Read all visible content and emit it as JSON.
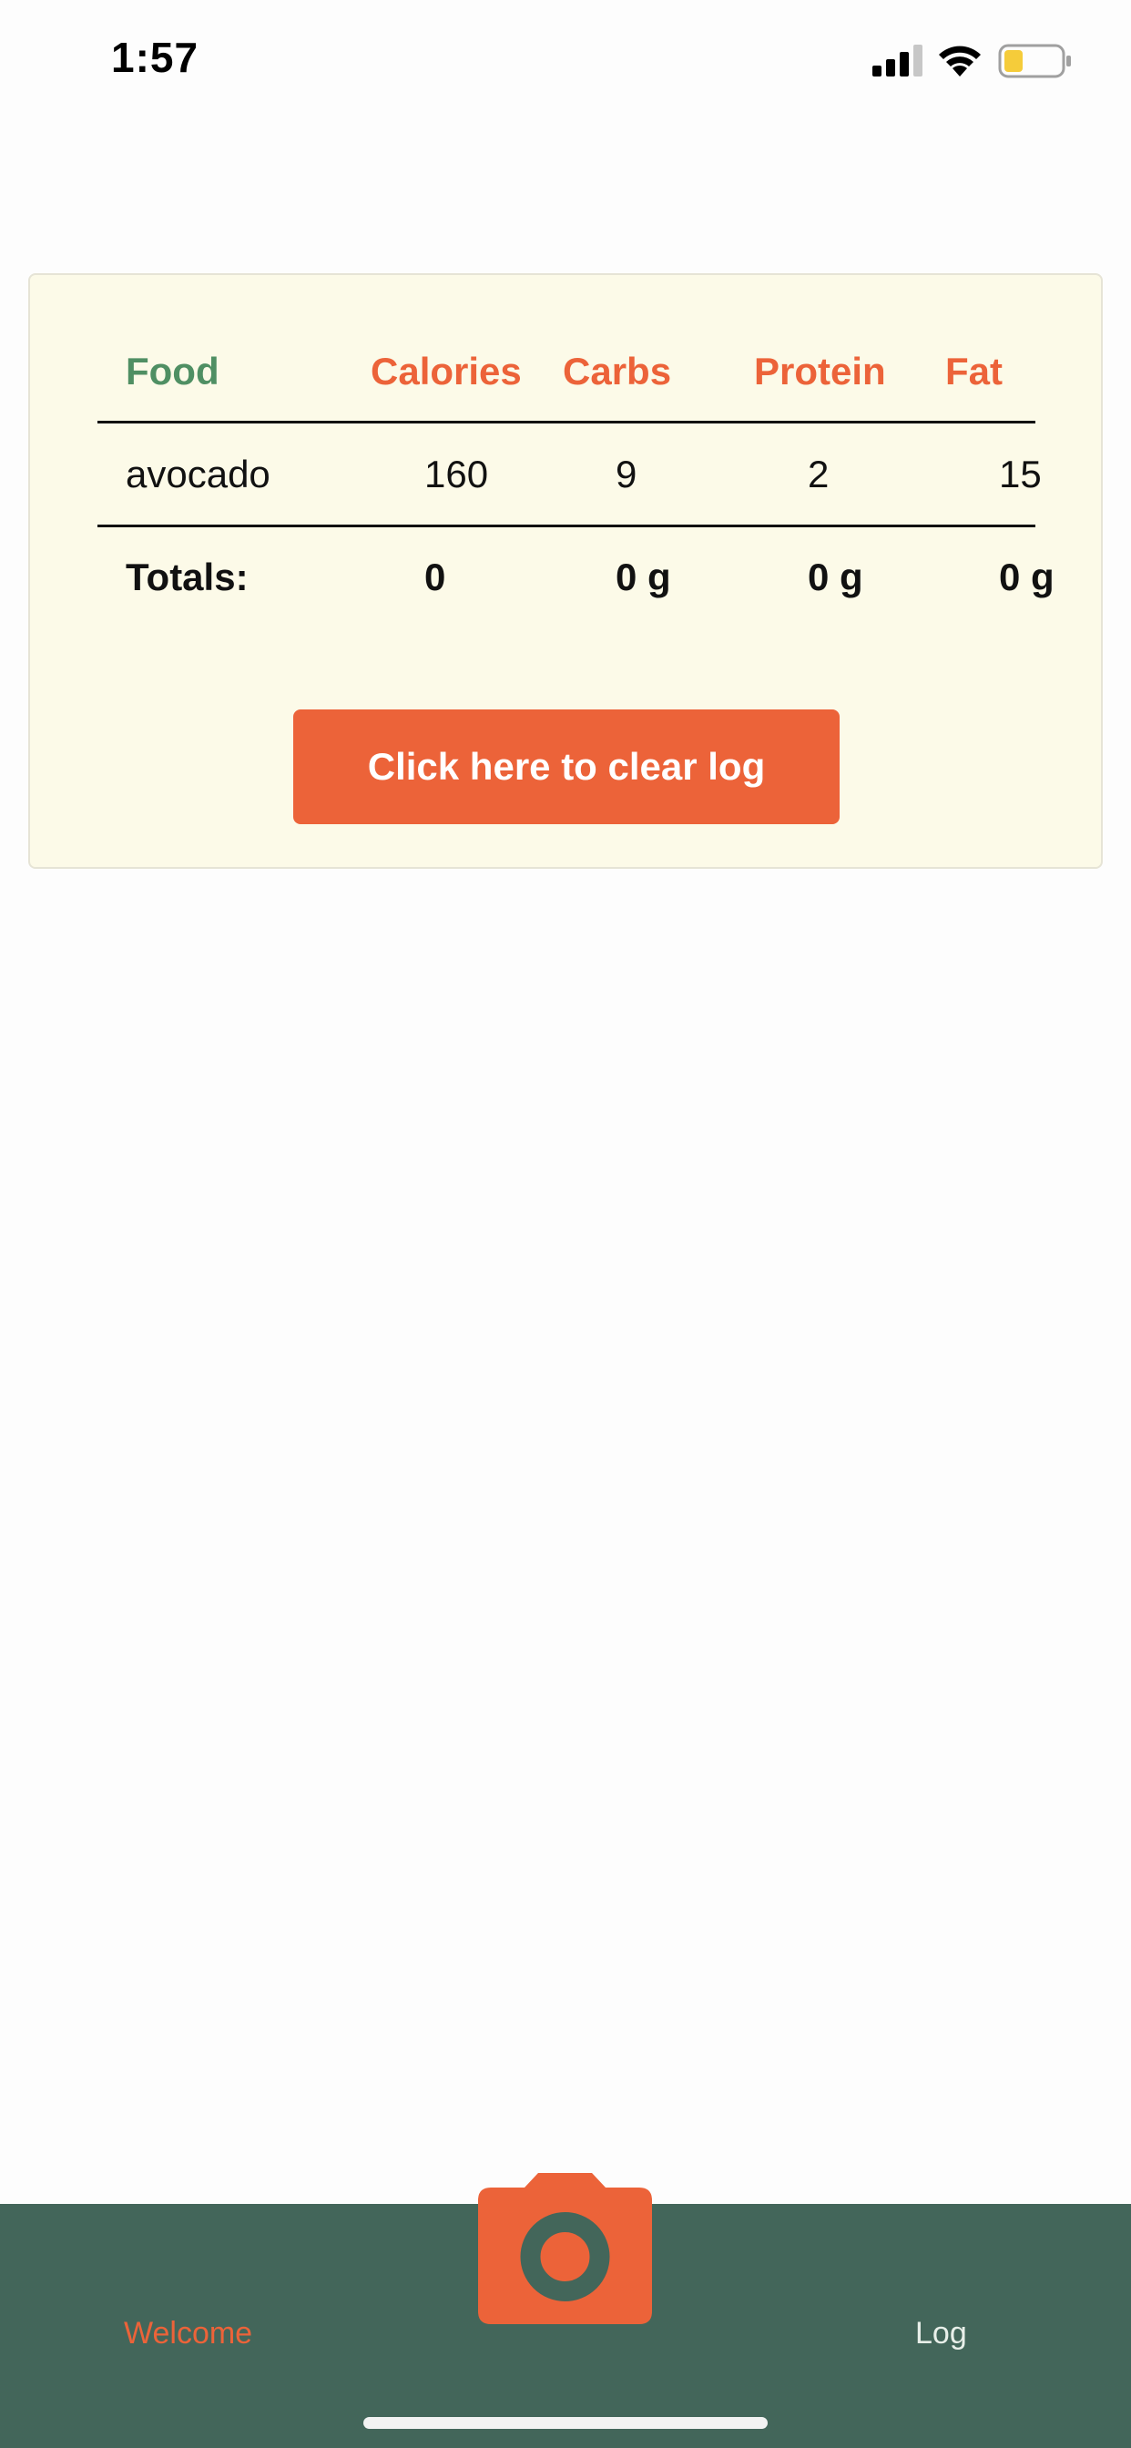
{
  "status_bar": {
    "time": "1:57"
  },
  "table": {
    "headers": {
      "food": "Food",
      "calories": "Calories",
      "carbs": "Carbs",
      "protein": "Protein",
      "fat": "Fat"
    },
    "rows": [
      {
        "food": "avocado",
        "calories": "160",
        "carbs": "9",
        "protein": "2",
        "fat": "15"
      }
    ],
    "totals": {
      "label": "Totals:",
      "calories": "0",
      "carbs": "0 g",
      "protein": "0 g",
      "fat": "0 g"
    }
  },
  "clear_button_label": "Click here to clear log",
  "tab_bar": {
    "welcome_label": "Welcome",
    "log_label": "Log",
    "center_icon": "camera-icon"
  },
  "colors": {
    "accent": "#ec6339",
    "food_header": "#4f8f63",
    "card_bg": "#fcfae8",
    "tab_bar_bg": "#43665a"
  }
}
